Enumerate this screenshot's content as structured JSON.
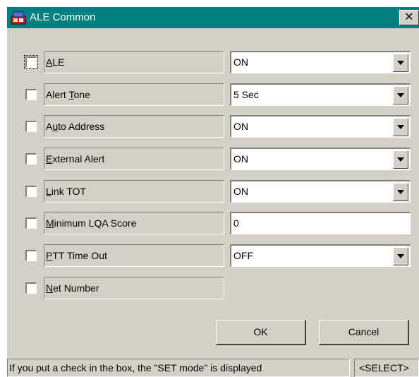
{
  "window": {
    "title": "ALE Common",
    "close_label": "✕"
  },
  "rows": [
    {
      "label": "ALE",
      "mnemonic": "A",
      "control": "select",
      "value": "ON",
      "checked": false
    },
    {
      "label": "Alert Tone",
      "mnemonic": "T",
      "control": "select",
      "value": "5 Sec",
      "checked": false
    },
    {
      "label": "Auto Address",
      "mnemonic": "u",
      "control": "select",
      "value": "ON",
      "checked": false
    },
    {
      "label": "External Alert",
      "mnemonic": "E",
      "control": "select",
      "value": "ON",
      "checked": false
    },
    {
      "label": "Link TOT",
      "mnemonic": "L",
      "control": "select",
      "value": "ON",
      "checked": false
    },
    {
      "label": "Minimum LQA Score",
      "mnemonic": "M",
      "control": "text",
      "value": "0",
      "checked": false
    },
    {
      "label": "PTT Time Out",
      "mnemonic": "P",
      "control": "select",
      "value": "OFF",
      "checked": false
    },
    {
      "label": "Net Number",
      "mnemonic": "N",
      "control": "none",
      "value": "",
      "checked": false
    }
  ],
  "buttons": {
    "ok": "OK",
    "cancel": "Cancel"
  },
  "statusbar": {
    "message": "If you put a check in the box, the \"SET mode\" is displayed",
    "mode": "<SELECT>"
  },
  "colors": {
    "titlebar": "#008080",
    "dialog_bg": "#d4d0c8",
    "field_bg": "#ffffff"
  },
  "icons": {
    "app": "radio-device-icon",
    "dropdown": "chevron-down-icon"
  }
}
